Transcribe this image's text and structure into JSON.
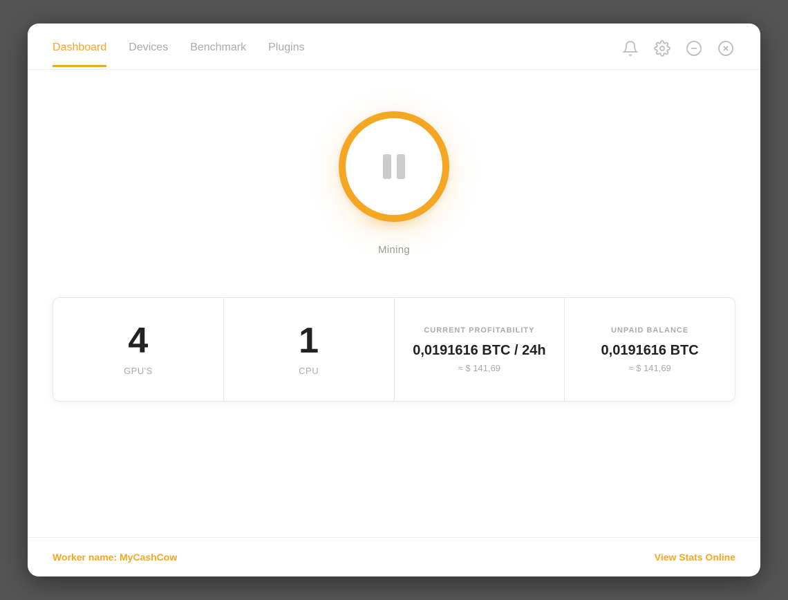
{
  "nav": {
    "tabs": [
      {
        "id": "dashboard",
        "label": "Dashboard",
        "active": true
      },
      {
        "id": "devices",
        "label": "Devices",
        "active": false
      },
      {
        "id": "benchmark",
        "label": "Benchmark",
        "active": false
      },
      {
        "id": "plugins",
        "label": "Plugins",
        "active": false
      }
    ]
  },
  "header_actions": {
    "bell_label": "Notifications",
    "gear_label": "Settings",
    "minimize_label": "Minimize",
    "close_label": "Close"
  },
  "mining": {
    "button_state": "paused",
    "status_label": "Mining"
  },
  "stats": [
    {
      "id": "gpus",
      "type": "number",
      "value": "4",
      "unit": "GPU'S"
    },
    {
      "id": "cpu",
      "type": "number",
      "value": "1",
      "unit": "CPU"
    },
    {
      "id": "profitability",
      "type": "detail",
      "label": "CURRENT PROFITABILITY",
      "main_value": "0,0191616 BTC / 24h",
      "sub_value": "≈ $ 141,69"
    },
    {
      "id": "balance",
      "type": "detail",
      "label": "UNPAID BALANCE",
      "main_value": "0,0191616 BTC",
      "sub_value": "≈ $ 141,69"
    }
  ],
  "footer": {
    "worker_prefix": "Worker name: ",
    "worker_name": "MyCashCow",
    "view_stats_label": "View Stats Online"
  },
  "colors": {
    "accent": "#f5a623",
    "text_primary": "#222",
    "text_secondary": "#aaa",
    "border": "#e8e8e8"
  }
}
